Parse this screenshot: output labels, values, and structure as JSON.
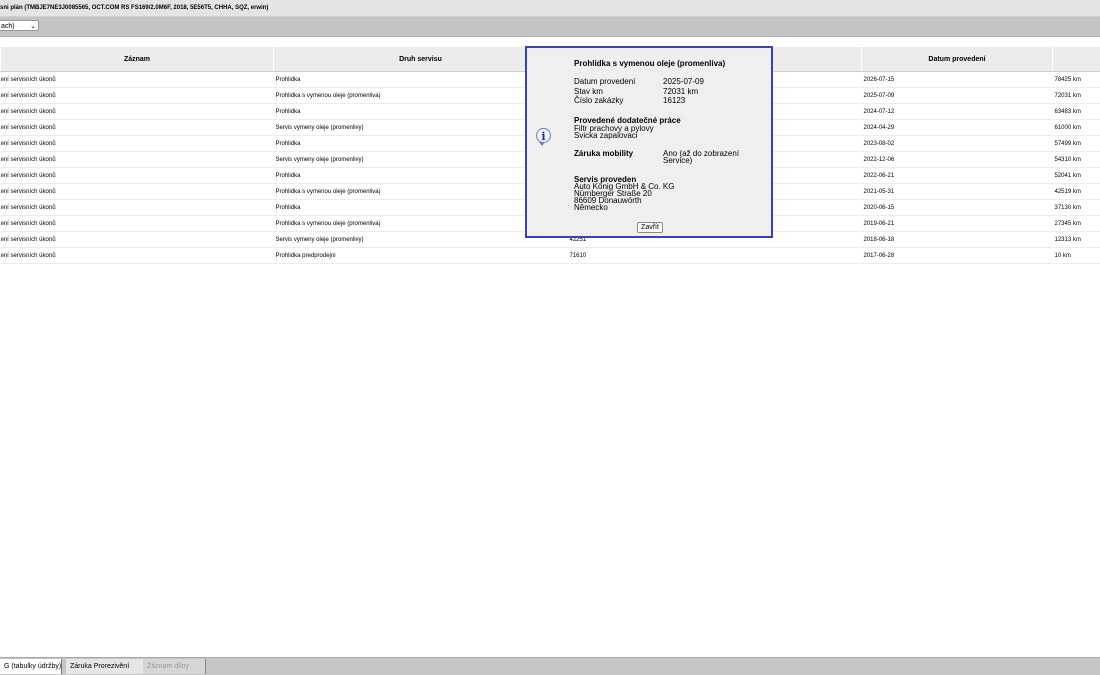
{
  "window": {
    "title": "sni plán (TMBJE7NE3J0085565, OCT.COM RS FS169/2.0M6F, 2018, 5E56T5, CHHA, SQZ, erwin)"
  },
  "toolbar": {
    "select_value": "ach)"
  },
  "table": {
    "headers": [
      "Záznam",
      "Druh servisu",
      "",
      "Datum provedení",
      ""
    ],
    "rows": [
      {
        "record": "ení servisních úkonů",
        "type": "Prohlidka",
        "order": "",
        "date": "2026-07-15",
        "km": "78425 km"
      },
      {
        "record": "ení servisních úkonů",
        "type": "Prohlidka s vymenou oleje (promenliva)",
        "order": "",
        "date": "2025-07-09",
        "km": "72031 km"
      },
      {
        "record": "ení servisních úkonů",
        "type": "Prohlidka",
        "order": "",
        "date": "2024-07-12",
        "km": "63483 km"
      },
      {
        "record": "ení servisních úkonů",
        "type": "Servis vymeny oleje (promenlivy)",
        "order": "",
        "date": "2024-04-29",
        "km": "61000 km"
      },
      {
        "record": "ení servisních úkonů",
        "type": "Prohlidka",
        "order": "",
        "date": "2023-08-02",
        "km": "57499 km"
      },
      {
        "record": "ení servisních úkonů",
        "type": "Servis vymeny oleje (promenlivy)",
        "order": "",
        "date": "2022-12-06",
        "km": "54310 km"
      },
      {
        "record": "ení servisních úkonů",
        "type": "Prohlidka",
        "order": "",
        "date": "2022-06-21",
        "km": "52041 km"
      },
      {
        "record": "ení servisních úkonů",
        "type": "Prohlidka s vymenou oleje (promenliva)",
        "order": "",
        "date": "2021-05-31",
        "km": "42519 km"
      },
      {
        "record": "ení servisních úkonů",
        "type": "Prohlidka",
        "order": "",
        "date": "2020-06-15",
        "km": "37130 km"
      },
      {
        "record": "ení servisních úkonů",
        "type": "Prohlidka s vymenou oleje (promenliva)",
        "order": "",
        "date": "2019-06-21",
        "km": "27345 km"
      },
      {
        "record": "ení servisních úkonů",
        "type": "Servis vymeny oleje (promenlivy)",
        "order": "42251",
        "date": "2018-06-18",
        "km": "12313 km"
      },
      {
        "record": "ení servisních úkonů",
        "type": "Prohlidka predprodejni",
        "order": "71610",
        "date": "2017-06-28",
        "km": "10 km"
      }
    ]
  },
  "modal": {
    "title": "Prohlidka s vymenou oleje (promenliva)",
    "fields": [
      {
        "label": "Datum provedení",
        "value": "2025-07-09"
      },
      {
        "label": "Stav km",
        "value": "72031 km"
      },
      {
        "label": "Číslo zakázky",
        "value": "16123"
      }
    ],
    "extra_work_title": "Provedené dodatečné práce",
    "extra_work": [
      "Filtr prachovy a pylovy",
      "Svicka zapalovaci"
    ],
    "mobility_label": "Záruka mobility",
    "mobility_value": [
      "Ano (až do zobrazení",
      "Service)"
    ],
    "service_title": "Servis proveden",
    "service_address": [
      "Auto König GmbH & Co. KG",
      "Nürnberger Straße 20",
      "86609 Donauwörth",
      "Německo"
    ],
    "close_label": "Zavřít",
    "icon": "info-icon"
  },
  "tabs": [
    {
      "label": "G (tabulky údržby)",
      "state": "active"
    },
    {
      "label": "Záruka Prorezivění",
      "state": "normal"
    },
    {
      "label": "Záznam dílny",
      "state": "disabled"
    }
  ]
}
